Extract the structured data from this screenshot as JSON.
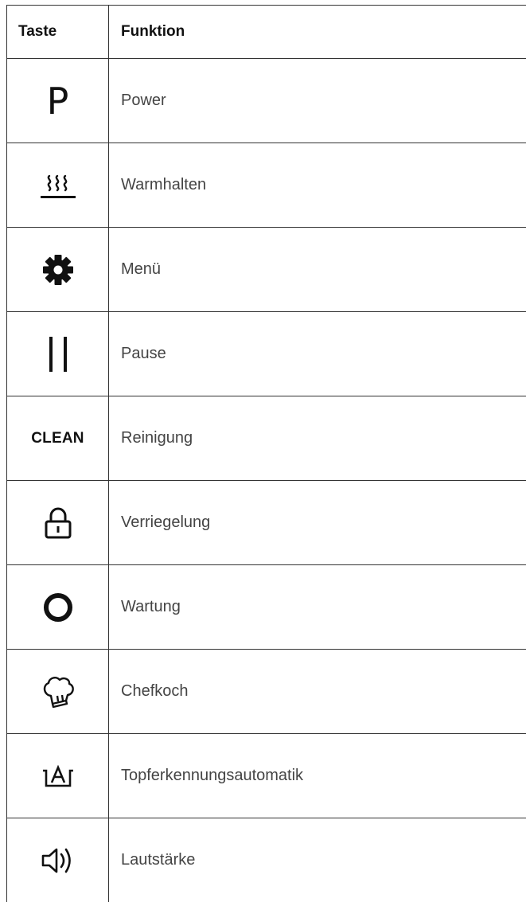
{
  "header": {
    "col_key": "Taste",
    "col_function": "Funktion"
  },
  "rows": [
    {
      "icon": "p-letter-icon",
      "glyph": "P",
      "label": "Power"
    },
    {
      "icon": "warming-heat-icon",
      "label": "Warmhalten"
    },
    {
      "icon": "gear-icon",
      "label": "Menü"
    },
    {
      "icon": "pause-icon",
      "label": "Pause"
    },
    {
      "icon": "clean-text-icon",
      "glyph": "CLEAN",
      "label": "Reinigung"
    },
    {
      "icon": "lock-icon",
      "label": "Verriegelung"
    },
    {
      "icon": "ring-icon",
      "label": "Wartung"
    },
    {
      "icon": "chef-hat-icon",
      "label": "Chefkoch"
    },
    {
      "icon": "pot-auto-detect-icon",
      "label": "Topferkennungsautomatik"
    },
    {
      "icon": "speaker-volume-icon",
      "label": "Lautstärke"
    }
  ]
}
